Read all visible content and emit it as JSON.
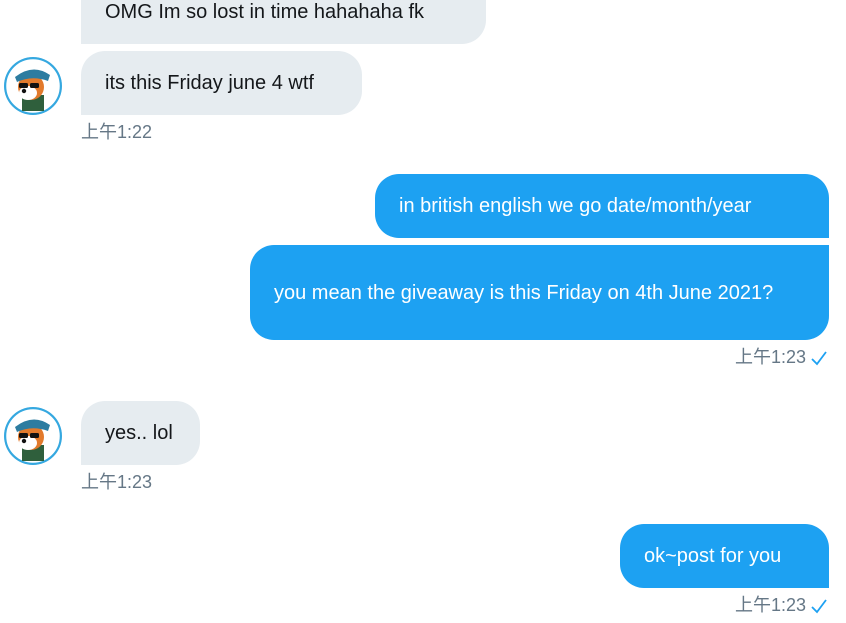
{
  "conversation": {
    "messages": [
      {
        "text": "OMG Im so lost in time hahahaha fk"
      },
      {
        "text": "its this Friday june 4 wtf",
        "time": "上午1:22"
      },
      {
        "text": "in british english we go date/month/year"
      },
      {
        "text": "you mean the giveaway is this Friday on 4th June 2021?",
        "time": "上午1:23"
      },
      {
        "text": "yes.. lol",
        "time": "上午1:23"
      },
      {
        "text": "ok~post for you",
        "time": "上午1:23"
      }
    ]
  },
  "colors": {
    "incoming": "#e6ecf0",
    "outgoing": "#1da1f2",
    "timestamp": "#657786"
  },
  "icons": {
    "avatar": "cartoon-dog-avatar-icon",
    "read_receipt": "checkmark-icon"
  }
}
